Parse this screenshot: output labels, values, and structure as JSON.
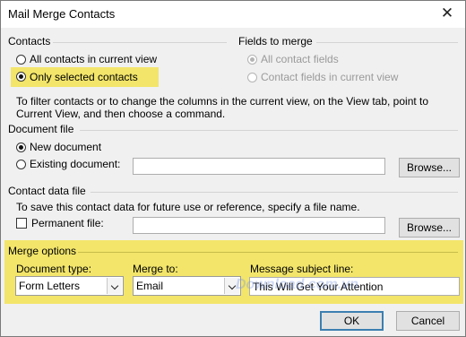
{
  "window": {
    "title": "Mail Merge Contacts",
    "close_glyph": "✕"
  },
  "contacts": {
    "label": "Contacts",
    "all_label": "All contacts in current view",
    "selected_label": "Only selected contacts",
    "selected_checked": true,
    "note": "To filter contacts or to change the columns in the current view, on the View tab, point to Current View, and then choose a command."
  },
  "fields": {
    "label": "Fields to merge",
    "all_label": "All contact fields",
    "current_label": "Contact fields in current view",
    "all_checked": true,
    "disabled": true
  },
  "document_file": {
    "label": "Document file",
    "new_label": "New document",
    "existing_label": "Existing document:",
    "new_checked": true,
    "existing_value": "",
    "browse_label": "Browse..."
  },
  "contact_data_file": {
    "label": "Contact data file",
    "note": "To save this contact data for future use or reference, specify a file name.",
    "permanent_label": "Permanent file:",
    "permanent_checked": false,
    "file_value": "",
    "browse_label": "Browse..."
  },
  "merge_options": {
    "label": "Merge options",
    "document_type_label": "Document type:",
    "document_type_value": "Form Letters",
    "merge_to_label": "Merge to:",
    "merge_to_value": "Email",
    "subject_label": "Message subject line:",
    "subject_value": "This Will Get Your Attention"
  },
  "buttons": {
    "ok": "OK",
    "cancel": "Cancel"
  },
  "watermark": "Download.com.vn",
  "colors": {
    "highlight": "#f2e56a",
    "default_button_border": "#3c7fb1"
  }
}
